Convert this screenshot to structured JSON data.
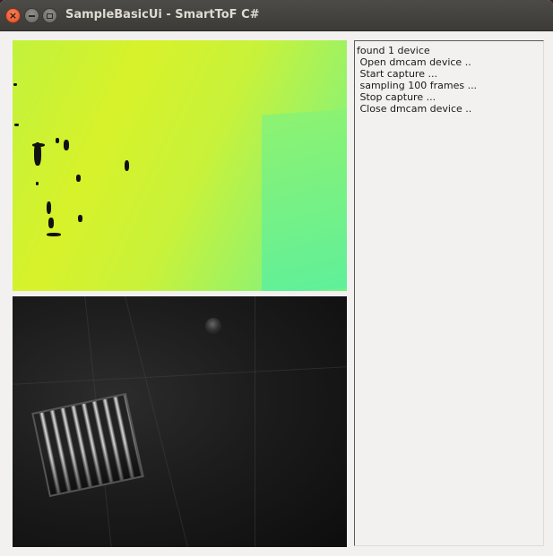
{
  "window": {
    "title": "SampleBasicUi - SmartToF C#",
    "buttons": {
      "close": "close-icon",
      "minimize": "minimize-icon",
      "maximize": "maximize-icon"
    }
  },
  "log": {
    "lines": [
      "found 1 device",
      " Open dmcam device ..",
      " Start capture ...",
      " sampling 100 frames ...",
      " Stop capture ...",
      " Close dmcam device .."
    ]
  },
  "colors": {
    "depth_near": "#d7f22a",
    "depth_far": "#5ff09a",
    "titlebar": "#3c3b37",
    "close_button": "#e0502a"
  }
}
